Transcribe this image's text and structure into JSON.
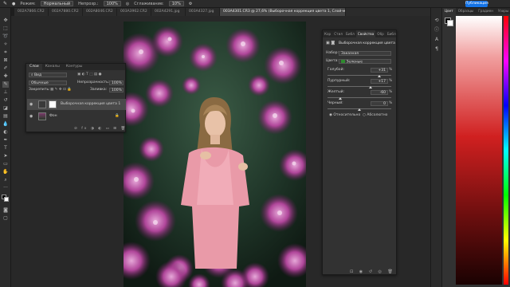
{
  "options_bar": {
    "mode_label": "Режим:",
    "mode_value": "Нормальный",
    "opacity_label": "Непрозр.:",
    "opacity_value": "100%",
    "smoothing_label": "Сглаживание:",
    "smoothing_value": "10%"
  },
  "publish_button": "Публикация",
  "tabs": [
    {
      "label": "002A7866.CR2"
    },
    {
      "label": "002A7880.CR2"
    },
    {
      "label": "002A8046.CR2"
    },
    {
      "label": "003A3962.CR2"
    },
    {
      "label": "002A4291.jpg"
    },
    {
      "label": "003A4327.jpg"
    },
    {
      "label": "003A4301.CR3 @ 27,6% (Выборочная коррекция цвета 1, Слой-маска/16) *"
    }
  ],
  "layers_panel": {
    "tabs": [
      "Слои",
      "Каналы",
      "Контуры"
    ],
    "active_tab": "Слои",
    "filter_label": "Вид",
    "blend_mode": "Обычные",
    "opacity_label": "Непрозрачность:",
    "opacity_value": "100%",
    "lock_label": "Закрепить:",
    "fill_label": "Заливка:",
    "fill_value": "100%",
    "layers": [
      {
        "name": "Выборочная коррекция цвета 1",
        "selected": true
      },
      {
        "name": "Фон",
        "selected": false
      }
    ]
  },
  "properties_panel": {
    "tabs": [
      "Кор",
      "Стил",
      "Библ",
      "Свойства",
      "Обр",
      "Библ"
    ],
    "active_tab": "Свойства",
    "title": "Выборочная коррекция цвета",
    "preset_label": "Набор:",
    "preset_value": "Заказная",
    "colors_label": "Цвета:",
    "colors_value": "Зеленые",
    "colors_swatch": "#2e8b2e",
    "sliders": [
      {
        "label": "Голубой:",
        "value": "+31",
        "level": 0.81,
        "unit": "%"
      },
      {
        "label": "Пурпурный:",
        "value": "+17",
        "level": 0.67,
        "unit": "%"
      },
      {
        "label": "Желтый:",
        "value": "-60",
        "level": 0.2,
        "unit": "%"
      },
      {
        "label": "Черный:",
        "value": "0",
        "level": 0.5,
        "unit": "%"
      }
    ],
    "method_relative": "Относительно",
    "method_absolute": "Абсолютно"
  },
  "color_panel": {
    "tabs": [
      "Цвет",
      "Образцы",
      "Градиен",
      "Узоры"
    ],
    "active_tab": "Цвет"
  }
}
